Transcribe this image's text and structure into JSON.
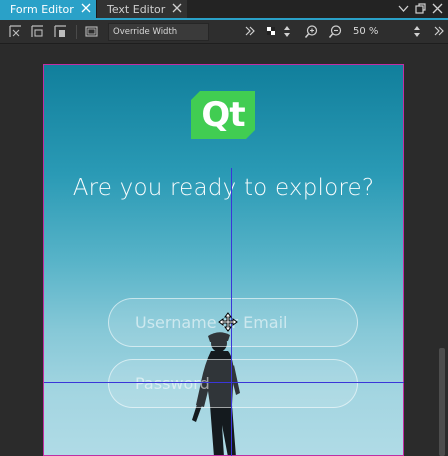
{
  "tabs": [
    {
      "label": "Form Editor",
      "active": true
    },
    {
      "label": "Text Editor",
      "active": false
    }
  ],
  "tabbar_icons": [
    "chevron-down-icon",
    "detach-icon",
    "close-icon"
  ],
  "toolbar": {
    "icons": [
      "snap-margins-icon",
      "snap-anchors-icon",
      "snap-position-icon",
      "select-area-icon"
    ],
    "resize_mode": "Override Width",
    "zoom": "50 %",
    "overflow_icon": "double-chevron-right-icon"
  },
  "form": {
    "logo_text": "Qt",
    "headline": "Are you ready to explore?",
    "username_placeholder": "Username or Email",
    "password_placeholder": "Password"
  },
  "colors": {
    "accent": "#2aa1c8",
    "qt_green": "#41cd52",
    "form_border": "#c22ea3",
    "guide": "#3a36d8"
  }
}
